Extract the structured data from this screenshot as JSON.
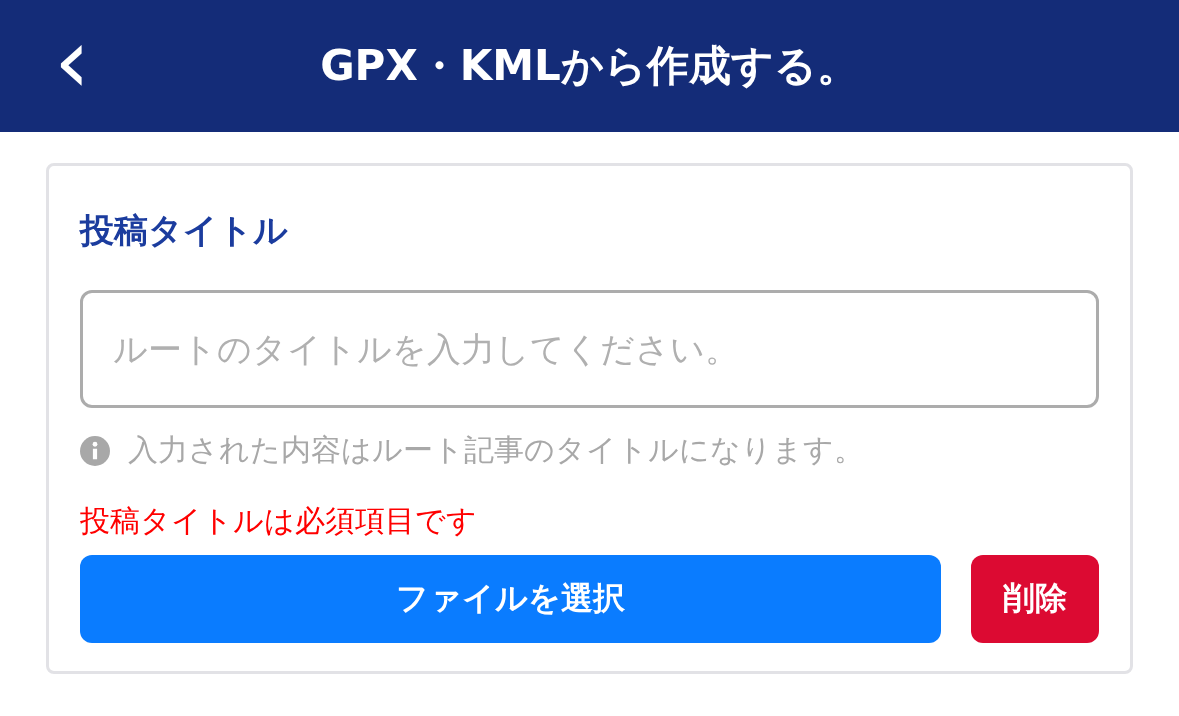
{
  "header": {
    "back_icon": "‹",
    "title": "GPX・KMLから作成する。"
  },
  "form": {
    "label": "投稿タイトル",
    "title_field": {
      "placeholder": "ルートのタイトルを入力してください。"
    },
    "hint": "入力された内容はルート記事のタイトルになります。",
    "error": "投稿タイトルは必須項目です",
    "buttons": [
      {
        "kind": "primary",
        "label": "ファイルを選択"
      },
      {
        "kind": "danger",
        "label": "削除"
      }
    ]
  }
}
